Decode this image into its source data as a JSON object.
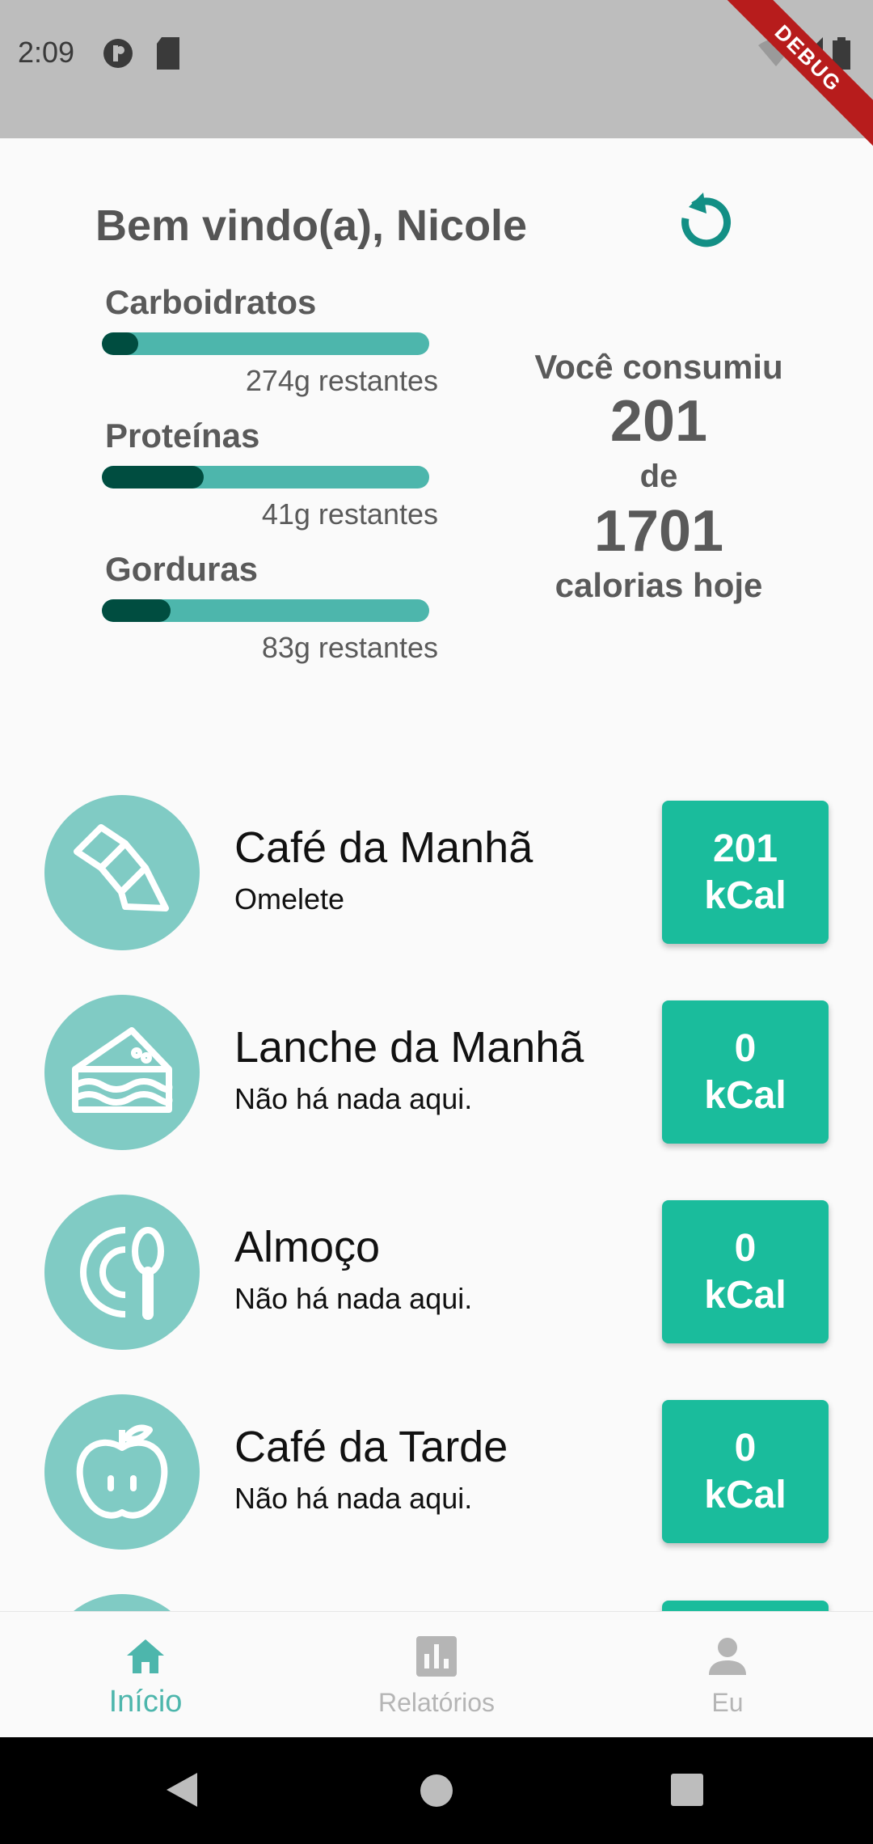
{
  "status_bar": {
    "time": "2:09",
    "debug_label": "DEBUG"
  },
  "header": {
    "welcome": "Bem vindo(a),  Nicole"
  },
  "macros": [
    {
      "label": "Carboidratos",
      "remaining": "274g restantes",
      "progress": 0.04
    },
    {
      "label": "Proteínas",
      "remaining": "41g restantes",
      "progress": 0.31
    },
    {
      "label": "Gorduras",
      "remaining": "83g restantes",
      "progress": 0.2
    }
  ],
  "calories": {
    "line1": "Você consumiu",
    "consumed": "201",
    "of": "de",
    "goal": "1701",
    "line2": "calorias hoje"
  },
  "meals": [
    {
      "title": "Café da Manhã",
      "subtitle": "Omelete",
      "kcal": "201",
      "unit": "kCal",
      "icon": "croissant-icon"
    },
    {
      "title": "Lanche da Manhã",
      "subtitle": "Não há nada aqui.",
      "kcal": "0",
      "unit": "kCal",
      "icon": "cake-slice-icon"
    },
    {
      "title": "Almoço",
      "subtitle": "Não há nada aqui.",
      "kcal": "0",
      "unit": "kCal",
      "icon": "plate-spoon-icon"
    },
    {
      "title": "Café da Tarde",
      "subtitle": "Não há nada aqui.",
      "kcal": "0",
      "unit": "kCal",
      "icon": "apple-icon"
    }
  ],
  "nav": {
    "home": "Início",
    "reports": "Relatórios",
    "me": "Eu"
  },
  "colors": {
    "accent": "#4db6ac",
    "dark_fill": "#004d40",
    "kcal_button": "#1abc9c",
    "circle": "#80cbc4"
  }
}
